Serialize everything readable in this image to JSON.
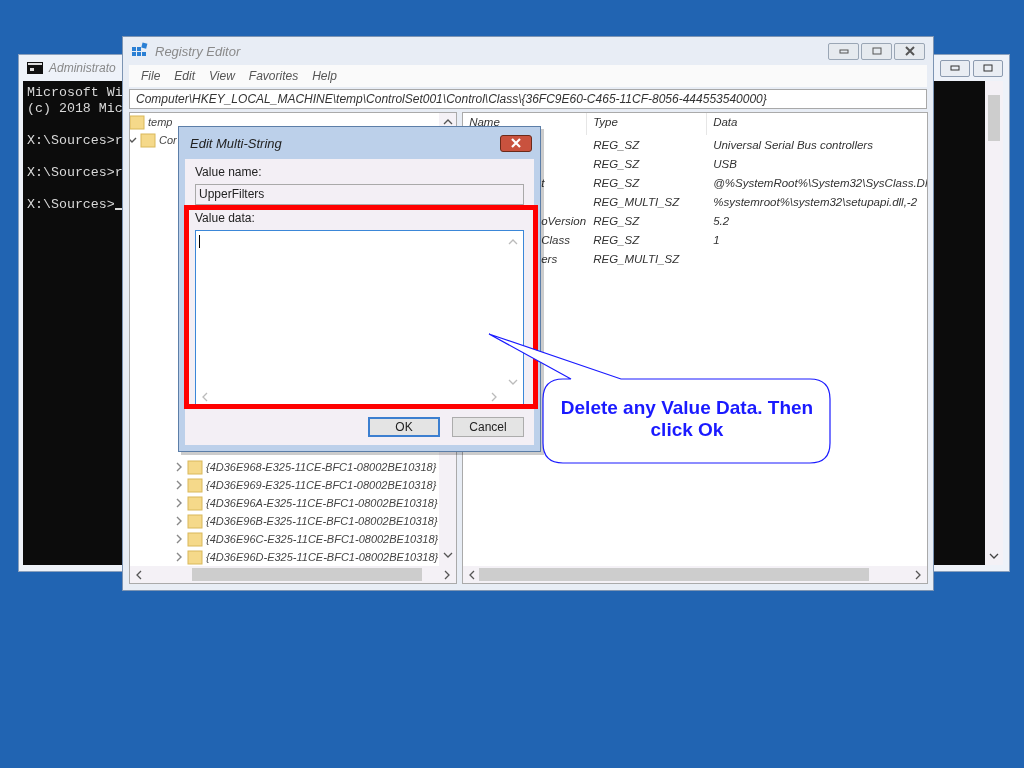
{
  "console": {
    "title": "Administrato",
    "blocks": [
      [
        "Microsoft Wi",
        "(c) 2018 Mic"
      ],
      [
        "X:\\Sources>r"
      ],
      [
        "X:\\Sources>r"
      ],
      [
        "X:\\Sources>"
      ]
    ],
    "cursor": true
  },
  "registry_editor": {
    "title": "Registry Editor",
    "menu": [
      "File",
      "Edit",
      "View",
      "Favorites",
      "Help"
    ],
    "address": "Computer\\HKEY_LOCAL_MACHINE\\temp\\ControlSet001\\Control\\Class\\{36FC9E60-C465-11CF-8056-444553540000}",
    "tree": [
      {
        "label": "temp",
        "children": [
          {
            "label": "Cor",
            "expanded": true,
            "children": [
              {
                "label": "{4D36E968-E325-11CE-BFC1-08002BE10318}",
                "expanded": false
              },
              {
                "label": "{4D36E969-E325-11CE-BFC1-08002BE10318}",
                "expanded": false
              },
              {
                "label": "{4D36E96A-E325-11CE-BFC1-08002BE10318}",
                "expanded": false
              },
              {
                "label": "{4D36E96B-E325-11CE-BFC1-08002BE10318}",
                "expanded": false
              },
              {
                "label": "{4D36E96C-E325-11CE-BFC1-08002BE10318}",
                "expanded": false
              },
              {
                "label": "{4D36E96D-E325-11CE-BFC1-08002BE10318}",
                "expanded": false
              }
            ]
          }
        ]
      }
    ],
    "columns": [
      "Name",
      "Type",
      "Data"
    ],
    "rows": [
      {
        "type": "REG_SZ",
        "data": "Universal Serial Bus controllers"
      },
      {
        "type": "REG_SZ",
        "data": "USB"
      },
      {
        "name": "t",
        "type": "REG_SZ",
        "data": "@%SystemRoot%\\System32\\SysClass.Dl"
      },
      {
        "type": "REG_MULTI_SZ",
        "data": "%systemroot%\\system32\\setupapi.dll,-2"
      },
      {
        "name": "oVersion",
        "type": "REG_SZ",
        "data": "5.2"
      },
      {
        "name": "Class",
        "type": "REG_SZ",
        "data": "1"
      },
      {
        "name": "ers",
        "type": "REG_MULTI_SZ"
      }
    ]
  },
  "dialog": {
    "title": "Edit Multi-String",
    "value_name_label": "Value name:",
    "value_name": "UpperFilters",
    "value_data_label": "Value data:",
    "buttons": [
      {
        "label": "OK",
        "default": true
      },
      {
        "label": "Cancel",
        "default": false
      }
    ]
  },
  "callout": {
    "text": "Delete any Value Data. Then click Ok"
  }
}
